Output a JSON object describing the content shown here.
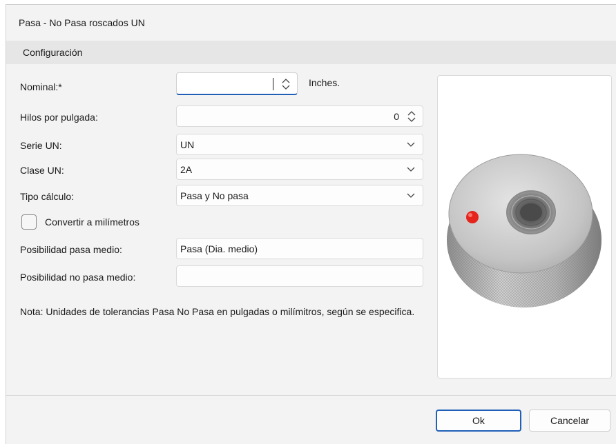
{
  "window": {
    "title": "Pasa - No Pasa roscados UN"
  },
  "section": {
    "header": "Configuración"
  },
  "form": {
    "nominal": {
      "label": "Nominal:*",
      "value": "",
      "units": "Inches."
    },
    "hilos": {
      "label": "Hilos por pulgada:",
      "value": "0"
    },
    "serie": {
      "label": "Serie UN:",
      "value": "UN"
    },
    "clase": {
      "label": "Clase UN:",
      "value": "2A"
    },
    "tipo": {
      "label": "Tipo cálculo:",
      "value": "Pasa y No pasa"
    },
    "convertir": {
      "label": "Convertir a milímetros",
      "checked": false
    },
    "pasa_medio": {
      "label": "Posibilidad pasa medio:",
      "value": "Pasa (Dia. medio)"
    },
    "no_pasa_medio": {
      "label": "Posibilidad no pasa medio:",
      "value": ""
    }
  },
  "note": "Nota: Unidades de tolerancias Pasa No Pasa en pulgadas o milímitros, según se especifica.",
  "buttons": {
    "ok": "Ok",
    "cancel": "Cancelar"
  },
  "colors": {
    "accent": "#1f5fb8",
    "marker": "#e5241b"
  },
  "image": {
    "icon": "thread-ring-gauge-image"
  }
}
